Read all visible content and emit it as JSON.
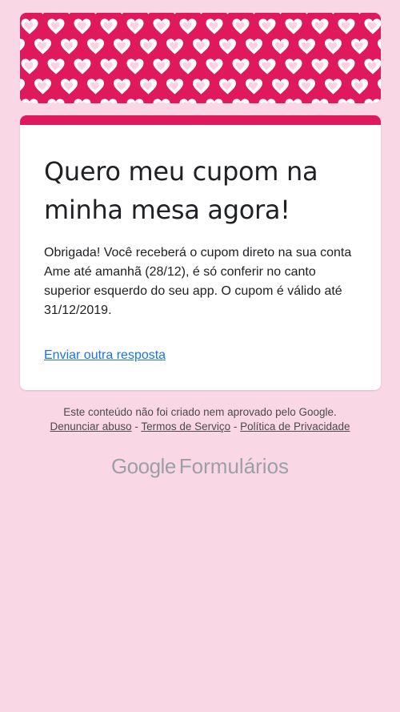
{
  "form": {
    "title": "Quero meu cupom na minha mesa agora!",
    "confirmation_message": "Obrigada! Você receberá o cupom direto na sua conta Ame até amanhã (28/12), é só conferir no canto superior esquerdo do seu app. O cupom é válido até 31/12/2019.",
    "submit_another_label": "Enviar outra resposta"
  },
  "footer": {
    "disclaimer": "Este conteúdo não foi criado nem aprovado pelo Google.",
    "report_abuse": "Denunciar abuso",
    "terms": "Termos de Serviço",
    "privacy": "Política de Privacidade",
    "separator": " - "
  },
  "branding": {
    "google": "Google",
    "product": "Formulários"
  },
  "theme": {
    "accent": "#e0195c",
    "background": "#fad7e4",
    "link": "#1a73e8"
  },
  "icons": {
    "banner_pattern": "heart-pattern"
  }
}
